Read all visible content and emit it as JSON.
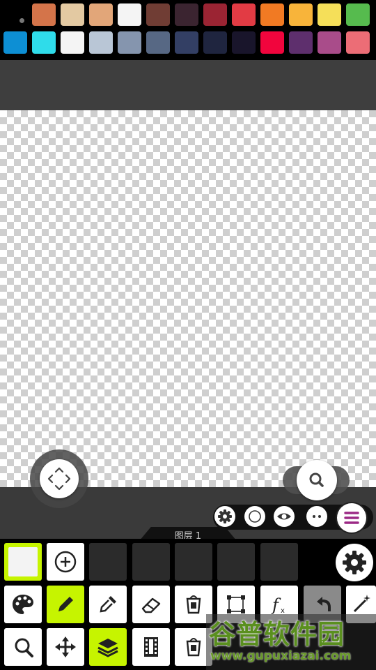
{
  "palette": {
    "row1": [
      "#d4744a",
      "#e3c9a2",
      "#e2a679",
      "#f4f4f4",
      "#703d34",
      "#3b2430",
      "#9b2433",
      "#e23b44",
      "#f17a23",
      "#f8b43a",
      "#f5df59",
      "#56bb4e"
    ],
    "row2": [
      "#0d8fd4",
      "#2fdcea",
      "#f4f4f4",
      "#b9c6d6",
      "#8595ae",
      "#576884",
      "#333f64",
      "#1f253f",
      "#19152b",
      "#f1053d",
      "#5e2f6d",
      "#a94c8a",
      "#ec6d76"
    ]
  },
  "layer": {
    "label": "图层 1"
  },
  "icons": {
    "move": "move-arrows-icon",
    "zoom": "magnifier-icon",
    "settings_small": "gear-icon",
    "circle": "circle-icon",
    "eye": "eye-icon",
    "more": "dots-icon",
    "menu": "hamburger-icon",
    "settings": "gear-icon"
  },
  "colors": {
    "accent": "#c6f400",
    "menu_accent": "#9c2a86"
  },
  "watermark": {
    "title": "谷普软件园",
    "url": "www.gupuxiazai.com"
  }
}
